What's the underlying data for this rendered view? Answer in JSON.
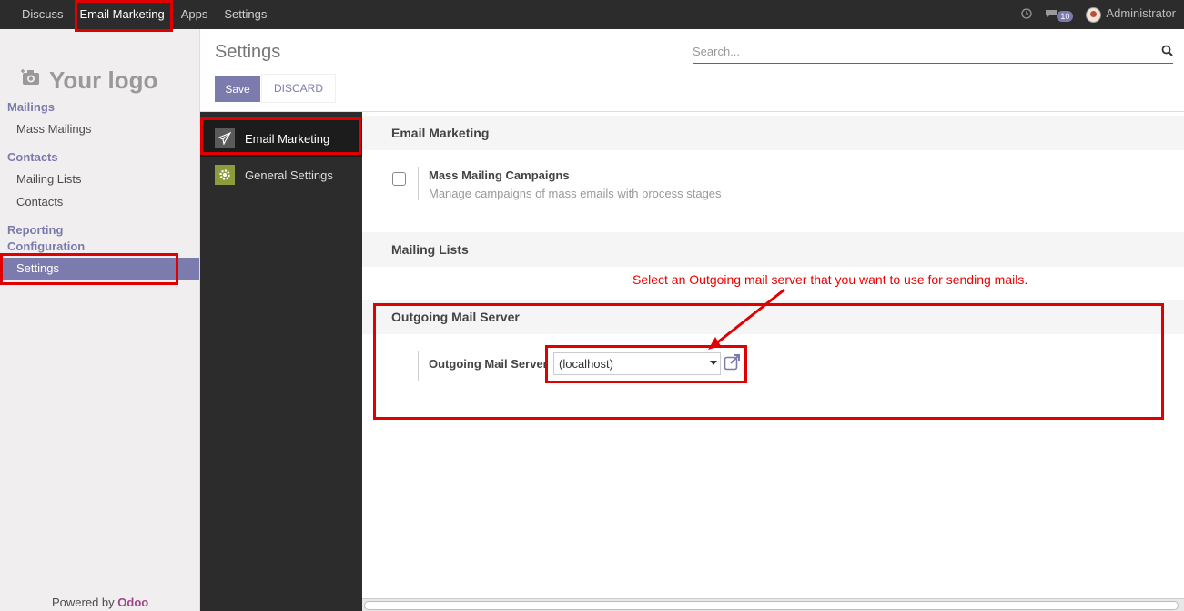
{
  "topbar": {
    "items": [
      "Discuss",
      "Email Marketing",
      "Apps",
      "Settings"
    ],
    "messages_count": "10",
    "user": "Administrator"
  },
  "sidebar": {
    "logo_text": "Your logo",
    "sections": {
      "mailings": "Mailings",
      "mass_mailings": "Mass Mailings",
      "contacts": "Contacts",
      "mailing_lists": "Mailing Lists",
      "contacts_item": "Contacts",
      "reporting": "Reporting",
      "configuration": "Configuration",
      "settings": "Settings"
    },
    "powered_by": "Powered by",
    "brand": "Odoo"
  },
  "control": {
    "title": "Settings",
    "search_placeholder": "Search...",
    "save_label": "Save",
    "discard_label": "DISCARD"
  },
  "settings_nav": {
    "email_marketing": "Email Marketing",
    "general_settings": "General Settings"
  },
  "main": {
    "section1": "Email Marketing",
    "option_title": "Mass Mailing Campaigns",
    "option_desc": "Manage campaigns of mass emails with process stages",
    "option_checked": false,
    "section2": "Mailing Lists",
    "section3": "Outgoing Mail Server",
    "mail_server_label": "Outgoing Mail Server",
    "mail_server_value": "(localhost)",
    "annotation": "Select an Outgoing mail server that you want to use for sending mails."
  },
  "colors": {
    "accent": "#7c7bad",
    "annotation": "#e00000",
    "topbar": "#2c2c2c"
  }
}
